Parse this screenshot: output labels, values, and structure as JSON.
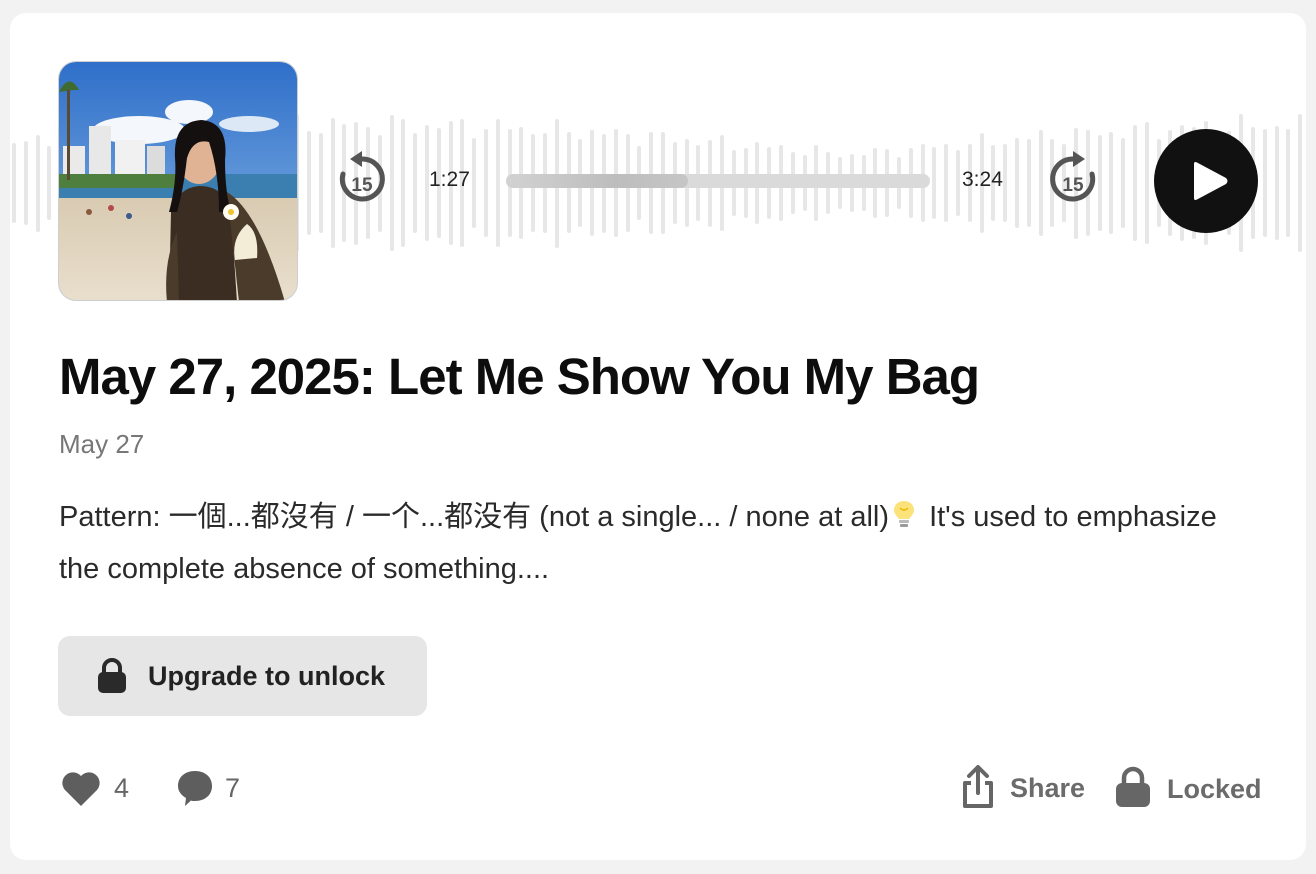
{
  "player": {
    "cover_alt": "Episode cover photo",
    "skip_back_seconds": "15",
    "skip_forward_seconds": "15",
    "elapsed": "1:27",
    "duration": "3:24",
    "progress_fraction": 0.43,
    "play_label": "Play"
  },
  "post": {
    "title": "May 27, 2025: Let Me Show You My Bag",
    "date": "May 27",
    "excerpt_before_icon": "Pattern: 一個...都沒有 / 一个...都没有 (not a single... / none at all)",
    "excerpt_after_icon": "It's used to emphasize the complete absence of something....",
    "upgrade_label": "Upgrade to unlock"
  },
  "footer": {
    "likes": "4",
    "comments": "7",
    "share_label": "Share",
    "locked_label": "Locked"
  },
  "icons": {
    "skip_back": "rewind-15-icon",
    "skip_forward": "forward-15-icon",
    "play": "play-icon",
    "lock": "lock-icon",
    "like": "heart-icon",
    "comment": "comment-icon",
    "share": "share-icon",
    "bulb": "lightbulb-icon"
  },
  "colors": {
    "play_button": "#111111",
    "waveform": "#e7e7e7",
    "upgrade_button": "#e6e6e6",
    "footer_text": "#666666"
  }
}
